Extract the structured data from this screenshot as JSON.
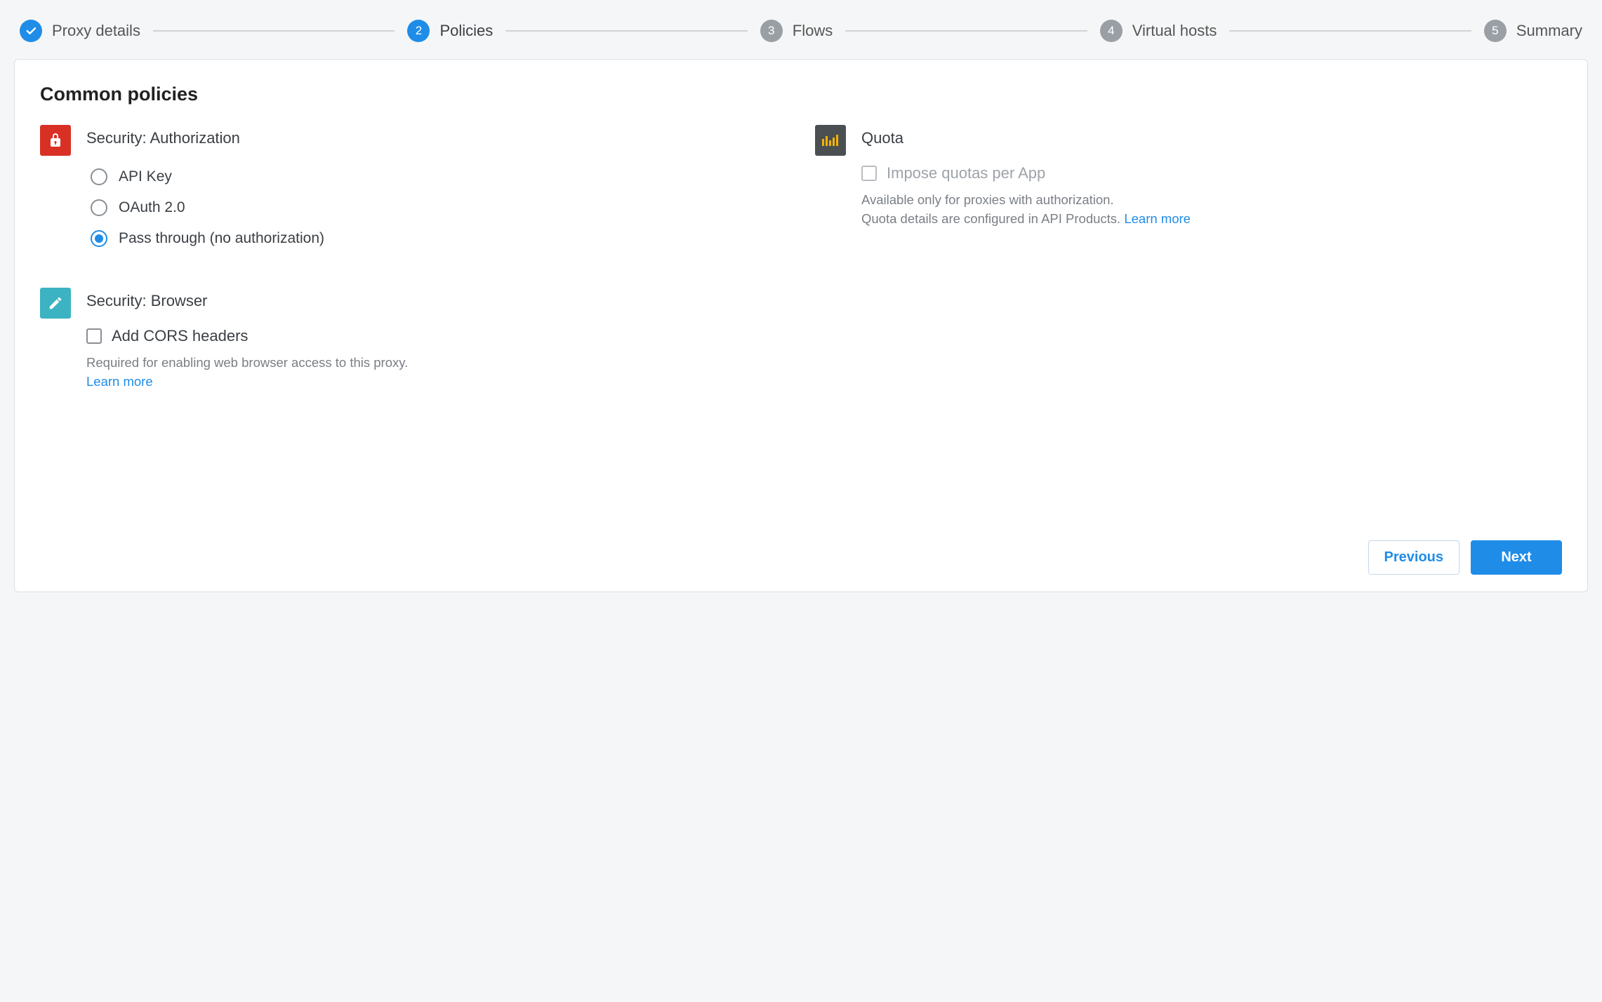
{
  "stepper": {
    "steps": [
      {
        "label": "Proxy details",
        "state": "done",
        "badge": "✓"
      },
      {
        "label": "Policies",
        "state": "current",
        "badge": "2"
      },
      {
        "label": "Flows",
        "state": "pending",
        "badge": "3"
      },
      {
        "label": "Virtual hosts",
        "state": "pending",
        "badge": "4"
      },
      {
        "label": "Summary",
        "state": "pending",
        "badge": "5"
      }
    ]
  },
  "page": {
    "heading": "Common policies"
  },
  "security_auth": {
    "title": "Security: Authorization",
    "options": {
      "api_key": {
        "label": "API Key",
        "selected": false
      },
      "oauth": {
        "label": "OAuth 2.0",
        "selected": false
      },
      "pass_through": {
        "label": "Pass through (no authorization)",
        "selected": true
      }
    }
  },
  "security_browser": {
    "title": "Security: Browser",
    "cors": {
      "label": "Add CORS headers",
      "checked": false,
      "hint": "Required for enabling web browser access to this proxy.",
      "learn_more": "Learn more"
    }
  },
  "quota": {
    "title": "Quota",
    "impose": {
      "label": "Impose quotas per App",
      "enabled": false,
      "hint_line1": "Available only for proxies with authorization.",
      "hint_line2": "Quota details are configured in API Products.",
      "learn_more": "Learn more"
    }
  },
  "footer": {
    "previous": "Previous",
    "next": "Next"
  },
  "colors": {
    "accent": "#1f8ce8",
    "security_icon_bg": "#d93025",
    "browser_icon_bg": "#3bb3c3",
    "quota_icon_bg": "#4b4f52"
  }
}
